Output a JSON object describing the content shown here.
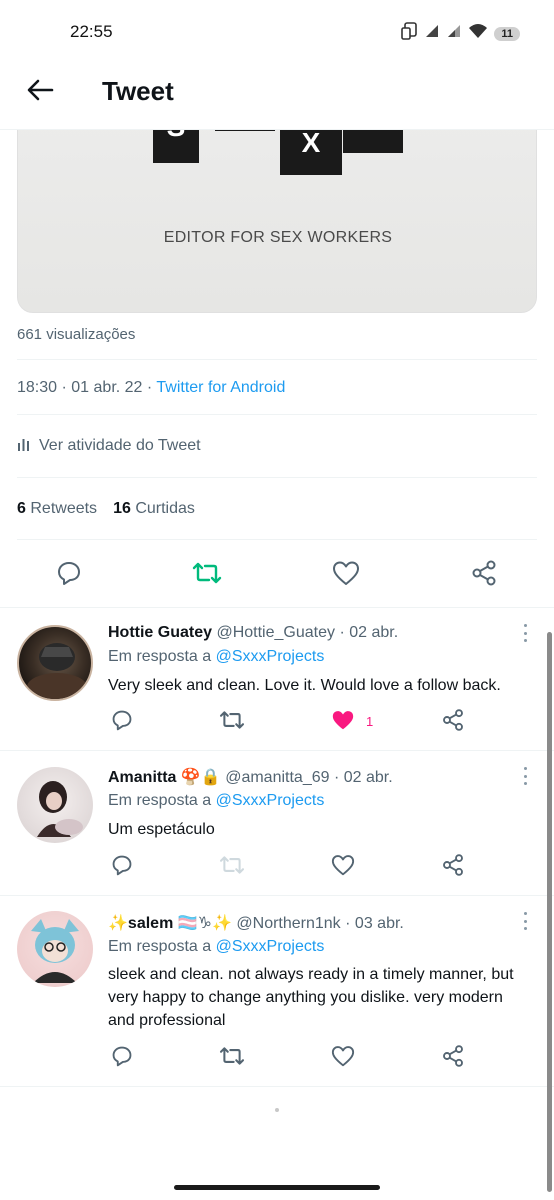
{
  "status_bar": {
    "time": "22:55",
    "battery": "11",
    "icons": [
      "screen-cast-icon",
      "signal-icon",
      "signal-icon",
      "wifi-icon",
      "battery-icon"
    ]
  },
  "header": {
    "title": "Tweet",
    "back_icon": "arrow-left-icon"
  },
  "media": {
    "logo_letters": [
      "S",
      "X"
    ],
    "caption": "EDITOR FOR SEX WORKERS"
  },
  "tweet": {
    "views": "661 visualizações",
    "time": "18:30",
    "date": "01 abr. 22",
    "source": "Twitter for Android",
    "activity_label": "Ver atividade do Tweet",
    "retweets_count": "6",
    "retweets_label": "Retweets",
    "likes_count": "16",
    "likes_label": "Curtidas"
  },
  "actions": {
    "icons": [
      "reply-icon",
      "retweet-icon",
      "like-icon",
      "share-icon"
    ],
    "retweet_color": "#00ba7c"
  },
  "replies": [
    {
      "name": "Hottie Guatey",
      "handle": "@Hottie_Guatey",
      "date": "02 abr.",
      "reply_prefix": "Em resposta a",
      "reply_to": "@SxxxProjects",
      "text": "Very sleek and clean. Love it. Would love a follow back.",
      "like_count": "1",
      "liked": true
    },
    {
      "name": "Amanitta",
      "name_emoji": "🍄🔒",
      "handle": "@amanitta_69",
      "date": "02 abr.",
      "reply_prefix": "Em resposta a",
      "reply_to": "@SxxxProjects",
      "text": "Um espetáculo",
      "liked": false
    },
    {
      "name_prefix_emoji": "✨",
      "name": "salem",
      "name_emoji": "🏳️‍⚧️♑✨",
      "handle": "@Northern1nk",
      "date": "03 abr.",
      "reply_prefix": "Em resposta a",
      "reply_to": "@SxxxProjects",
      "text": "sleek and clean. not always ready in a timely manner, but very happy to change anything you dislike. very modern and professional",
      "liked": false
    }
  ],
  "colors": {
    "link": "#1d9bf0",
    "like": "#f91880",
    "muted": "#536471",
    "text": "#0f1419"
  }
}
